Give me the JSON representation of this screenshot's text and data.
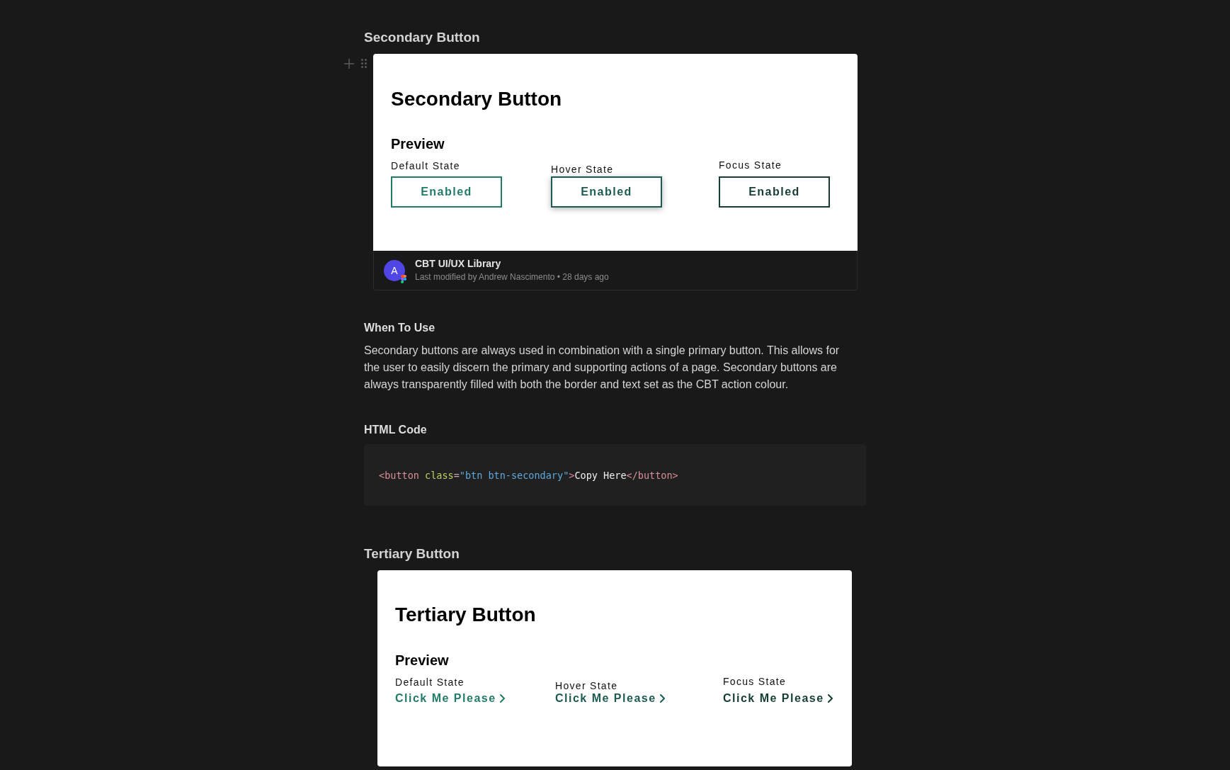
{
  "secondary_section": {
    "heading": "Secondary Button",
    "embed": {
      "kind": "outline",
      "title": "Secondary Button",
      "subtitle": "Preview",
      "states": [
        {
          "kind": "default",
          "label": "Default State",
          "control": "Enabled"
        },
        {
          "kind": "hover",
          "label": "Hover State",
          "control": "Enabled"
        },
        {
          "kind": "focus",
          "label": "Focus State",
          "control": "Enabled"
        }
      ],
      "footer": {
        "avatar": "A",
        "source": "CBT UI/UX Library",
        "meta": "Last modified by Andrew Nascimento • 28 days ago"
      }
    }
  },
  "when_to_use": {
    "heading": "When To Use",
    "text": "Secondary buttons are always used in combination with a single primary button. This allows for the user to easily discern the primary and supporting actions of a page. Secondary buttons are always transparently filled with both the border and text set as the CBT action colour."
  },
  "html_code": {
    "heading": "HTML Code",
    "tokens": [
      {
        "kind": "tag",
        "text": "<button"
      },
      {
        "kind": "attr",
        "text": " class"
      },
      {
        "kind": "punct",
        "text": "="
      },
      {
        "kind": "string",
        "text": "\"btn btn-secondary\""
      },
      {
        "kind": "tag",
        "text": ">"
      },
      {
        "kind": "text",
        "text": "Copy Here"
      },
      {
        "kind": "tag",
        "text": "</button>"
      }
    ]
  },
  "tertiary_section": {
    "heading": "Tertiary Button",
    "embed": {
      "kind": "text",
      "title": "Tertiary Button",
      "subtitle": "Preview",
      "states": [
        {
          "kind": "default",
          "label": "Default State",
          "control": "Click Me Please"
        },
        {
          "kind": "hover",
          "label": "Hover State",
          "control": "Click Me Please"
        },
        {
          "kind": "focus",
          "label": "Focus State",
          "control": "Click Me Please"
        }
      ]
    }
  }
}
